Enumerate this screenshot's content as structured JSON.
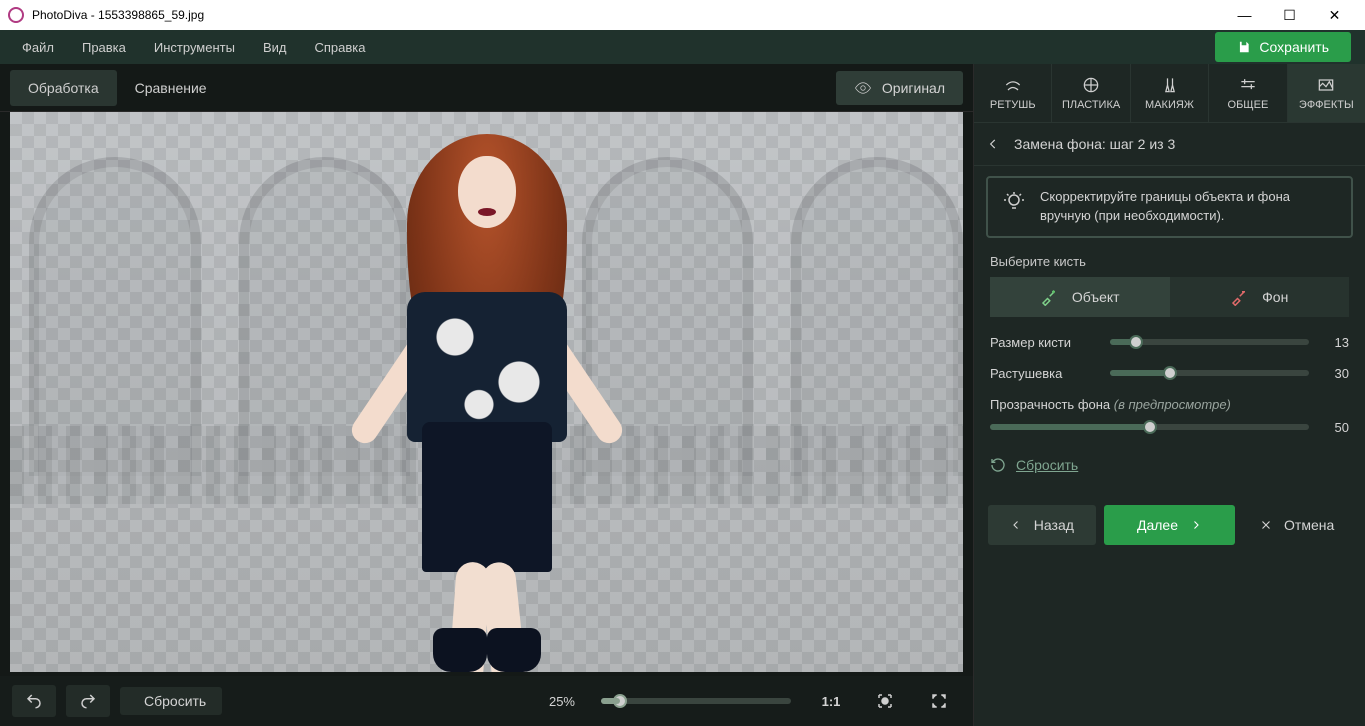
{
  "title": "PhotoDiva - 1553398865_59.jpg",
  "menu": {
    "file": "Файл",
    "edit": "Правка",
    "tools": "Инструменты",
    "view": "Вид",
    "help": "Справка"
  },
  "save_label": "Сохранить",
  "view_tabs": {
    "process": "Обработка",
    "compare": "Сравнение",
    "original": "Оригинал"
  },
  "tool_tabs": {
    "retouch": "РЕТУШЬ",
    "plastic": "ПЛАСТИКА",
    "makeup": "МАКИЯЖ",
    "general": "ОБЩЕЕ",
    "effects": "ЭФФЕКТЫ"
  },
  "panel_header": "Замена фона: шаг 2 из 3",
  "hint_text": "Скорректируйте границы объекта и фона вручную (при необходимости).",
  "brush_section_label": "Выберите кисть",
  "brush_tabs": {
    "object": "Объект",
    "background": "Фон"
  },
  "sliders": {
    "size": {
      "label": "Размер кисти",
      "value": "13",
      "pct": 13
    },
    "feather": {
      "label": "Растушевка",
      "value": "30",
      "pct": 30
    },
    "opacity": {
      "label": "Прозрачность фона",
      "hint": "(в предпросмотре)",
      "value": "50",
      "pct": 50
    }
  },
  "reset_link": "Сбросить",
  "nav": {
    "back": "Назад",
    "next": "Далее",
    "cancel": "Отмена"
  },
  "bottom": {
    "reset": "Сбросить",
    "zoom": "25%",
    "one_to_one": "1:1"
  }
}
